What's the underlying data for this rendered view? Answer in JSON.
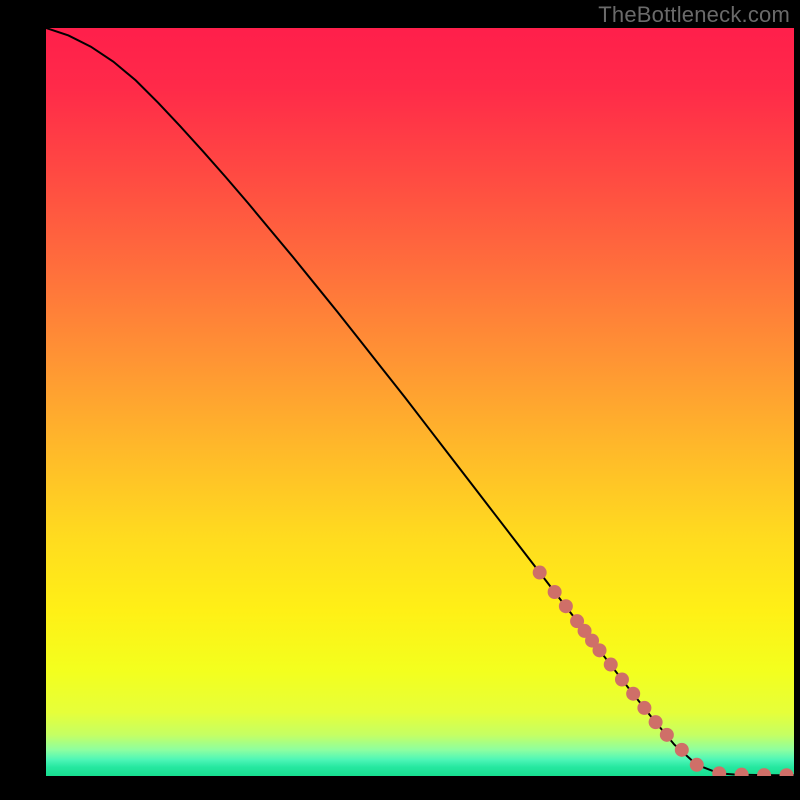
{
  "source_label": "TheBottleneck.com",
  "chart_data": {
    "type": "line",
    "title": "",
    "xlabel": "",
    "ylabel": "",
    "xlim": [
      0,
      100
    ],
    "ylim": [
      0,
      100
    ],
    "curve": {
      "x": [
        0,
        3,
        6,
        9,
        12,
        15,
        18,
        21,
        24,
        27,
        30,
        33,
        36,
        39,
        42,
        45,
        48,
        51,
        54,
        57,
        60,
        63,
        66,
        69,
        72,
        75,
        78,
        81,
        84,
        87,
        90,
        92,
        94,
        96,
        98,
        100
      ],
      "y": [
        100,
        99,
        97.5,
        95.5,
        93,
        90,
        86.8,
        83.5,
        80.1,
        76.6,
        73.0,
        69.4,
        65.7,
        62.0,
        58.2,
        54.4,
        50.6,
        46.7,
        42.8,
        38.9,
        35.0,
        31.1,
        27.2,
        23.3,
        19.4,
        15.5,
        11.6,
        7.8,
        4.2,
        1.5,
        0.35,
        0.2,
        0.15,
        0.12,
        0.1,
        0.1
      ]
    },
    "markers": {
      "x": [
        66,
        68,
        69.5,
        71,
        72,
        73,
        74,
        75.5,
        77,
        78.5,
        80,
        81.5,
        83,
        85,
        87,
        90,
        93,
        96,
        99
      ],
      "y": [
        27.2,
        24.6,
        22.7,
        20.7,
        19.4,
        18.1,
        16.8,
        14.9,
        12.9,
        11.0,
        9.1,
        7.2,
        5.5,
        3.5,
        1.5,
        0.35,
        0.18,
        0.12,
        0.1
      ],
      "color": "#cf6f68",
      "radius": 7
    },
    "gradient_stops": [
      {
        "offset": 0,
        "color": "#ff1f4b"
      },
      {
        "offset": 0.08,
        "color": "#ff2a49"
      },
      {
        "offset": 0.2,
        "color": "#ff4b42"
      },
      {
        "offset": 0.32,
        "color": "#ff6e3c"
      },
      {
        "offset": 0.44,
        "color": "#ff9334"
      },
      {
        "offset": 0.56,
        "color": "#ffb82a"
      },
      {
        "offset": 0.68,
        "color": "#ffdb1f"
      },
      {
        "offset": 0.78,
        "color": "#fff016"
      },
      {
        "offset": 0.86,
        "color": "#f3ff1e"
      },
      {
        "offset": 0.915,
        "color": "#e6ff3a"
      },
      {
        "offset": 0.945,
        "color": "#c5ff63"
      },
      {
        "offset": 0.965,
        "color": "#8dffa0"
      },
      {
        "offset": 0.978,
        "color": "#4ef6b7"
      },
      {
        "offset": 0.988,
        "color": "#26e8a0"
      },
      {
        "offset": 1.0,
        "color": "#17dd8f"
      }
    ]
  }
}
